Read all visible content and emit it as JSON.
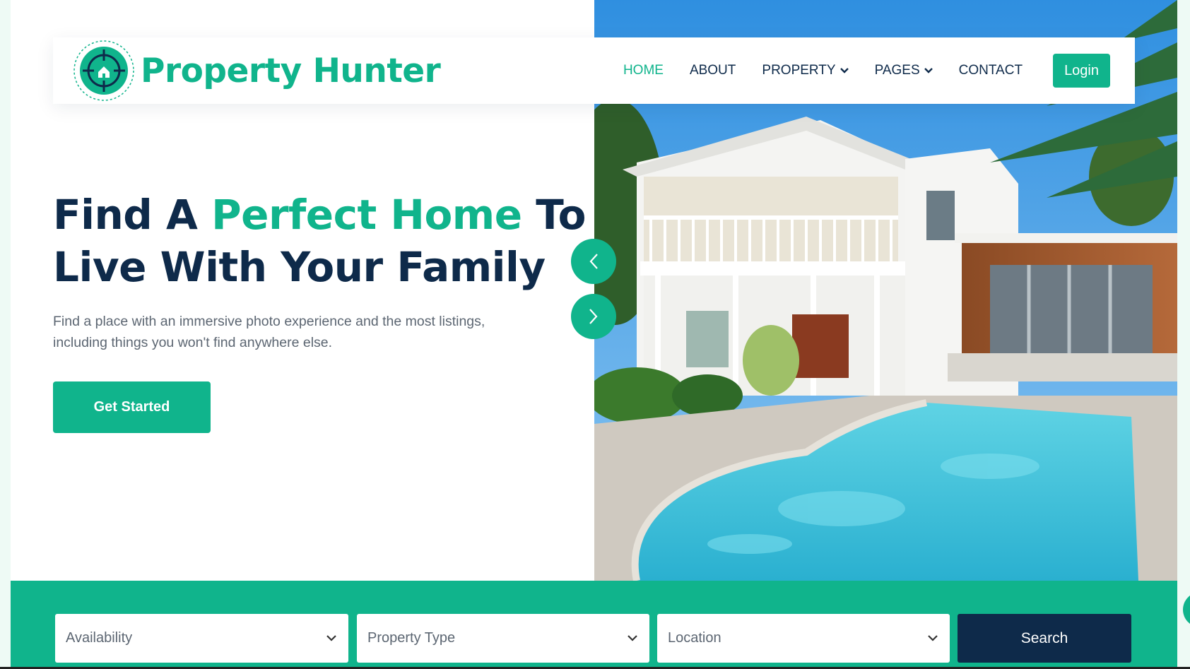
{
  "brand": {
    "name": "Property Hunter",
    "logo_icon": "target-home-icon"
  },
  "nav": {
    "items": [
      {
        "label": "HOME",
        "active": true
      },
      {
        "label": "ABOUT",
        "active": false
      },
      {
        "label": "PROPERTY",
        "active": false,
        "dropdown": true
      },
      {
        "label": "PAGES",
        "active": false,
        "dropdown": true
      },
      {
        "label": "CONTACT",
        "active": false
      }
    ],
    "login_label": "Login"
  },
  "hero": {
    "title_part1": "Find A ",
    "title_accent": "Perfect Home",
    "title_part2": " To Live With Your Family",
    "description": "Find a place with an immersive photo experience and the most listings, including things you won't find anywhere else.",
    "cta_label": "Get Started",
    "image_alt_icon": "house-with-pool-photo"
  },
  "slider": {
    "prev_icon": "chevron-left-icon",
    "next_icon": "chevron-right-icon"
  },
  "search": {
    "availability": "Availability",
    "property_type": "Property Type",
    "location": "Location",
    "button_label": "Search"
  },
  "colors": {
    "accent": "#10b48c",
    "navy": "#0e2a4a",
    "text_muted": "#5c6672"
  }
}
